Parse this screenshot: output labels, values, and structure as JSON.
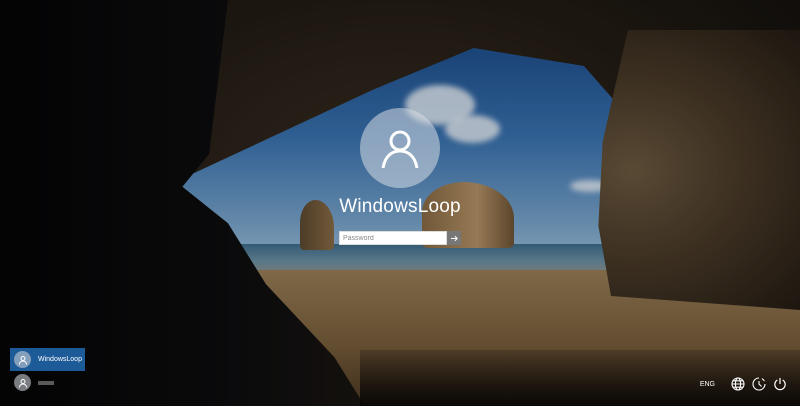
{
  "login": {
    "username": "WindowsLoop",
    "password_placeholder": "Password"
  },
  "user_list": [
    {
      "label": "WindowsLoop",
      "selected": true
    },
    {
      "label": "",
      "selected": false
    }
  ],
  "system_tray": {
    "language": "ENG",
    "icons": [
      "network-icon",
      "ease-of-access-icon",
      "power-icon"
    ]
  },
  "colors": {
    "selected_user_bg": "#1c5a98",
    "submit_button_bg": "#777777"
  }
}
